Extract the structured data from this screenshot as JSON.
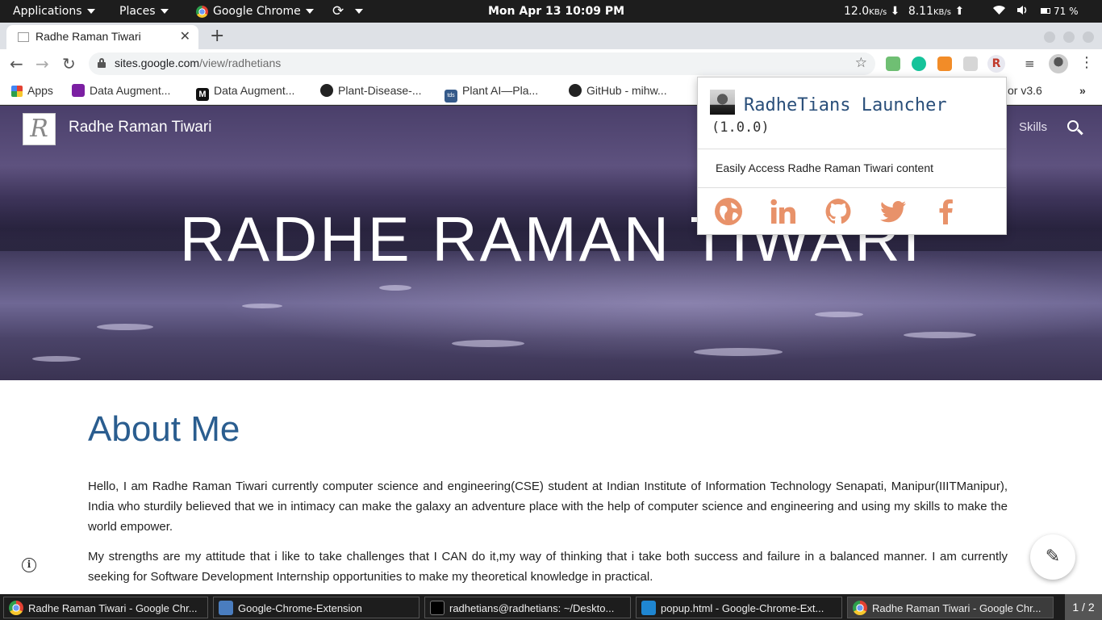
{
  "system_panel": {
    "applications_label": "Applications",
    "places_label": "Places",
    "app_label": "Google Chrome",
    "datetime": "Mon Apr 13  10:09 PM",
    "down_speed": "12.0",
    "up_speed": "8.11",
    "speed_unit": "KB/s",
    "battery": "71 %"
  },
  "browser": {
    "tab_title": "Radhe Raman Tiwari",
    "url_host": "sites.google.com",
    "url_path": "/view/radhetians",
    "bookmarks": [
      {
        "label": "Apps",
        "icon": "apps-grid-icon"
      },
      {
        "label": "Data Augment...",
        "icon": "data-augment-icon"
      },
      {
        "label": "Data Augment...",
        "icon": "medium-icon"
      },
      {
        "label": "Plant-Disease-...",
        "icon": "github-icon"
      },
      {
        "label": "Plant AI—Pla...",
        "icon": "tds-icon"
      },
      {
        "label": "GitHub - mihw...",
        "icon": "github-icon"
      },
      {
        "label": "or v3.6",
        "icon": ""
      }
    ],
    "overflow_label": "»"
  },
  "site": {
    "name": "Radhe Raman Tiwari",
    "logo_letter": "R",
    "nav_skills": "Skills",
    "hero_title": "RADHE RAMAN TIWARI",
    "about_heading": "About Me",
    "paragraph_1": "Hello, I am Radhe Raman Tiwari currently computer science and engineering(CSE) student at Indian Institute of Information Technology Senapati, Manipur(IIITManipur), India who sturdily believed that we in intimacy can make the galaxy an adventure place with the help of computer science and engineering and using my skills to make the world empower.",
    "paragraph_2": "My strengths are my attitude that i like to take challenges that I CAN do it,my way of thinking that i take both success and failure in a balanced manner. I am currently seeking for Software Development Internship opportunities to make my theoretical knowledge in practical."
  },
  "popup": {
    "title": "RadheTians Launcher",
    "version": "(1.0.0)",
    "description": "Easily Access Radhe Raman Tiwari content",
    "social": [
      "globe-icon",
      "linkedin-icon",
      "github-icon",
      "twitter-icon",
      "facebook-icon"
    ],
    "icon_color": "#e8926a"
  },
  "taskbar": {
    "items": [
      "Radhe Raman Tiwari - Google Chr...",
      "Google-Chrome-Extension",
      "radhetians@radhetians: ~/Deskto...",
      "popup.html - Google-Chrome-Ext...",
      "Radhe Raman Tiwari - Google Chr..."
    ],
    "pager": "1 / 2"
  }
}
